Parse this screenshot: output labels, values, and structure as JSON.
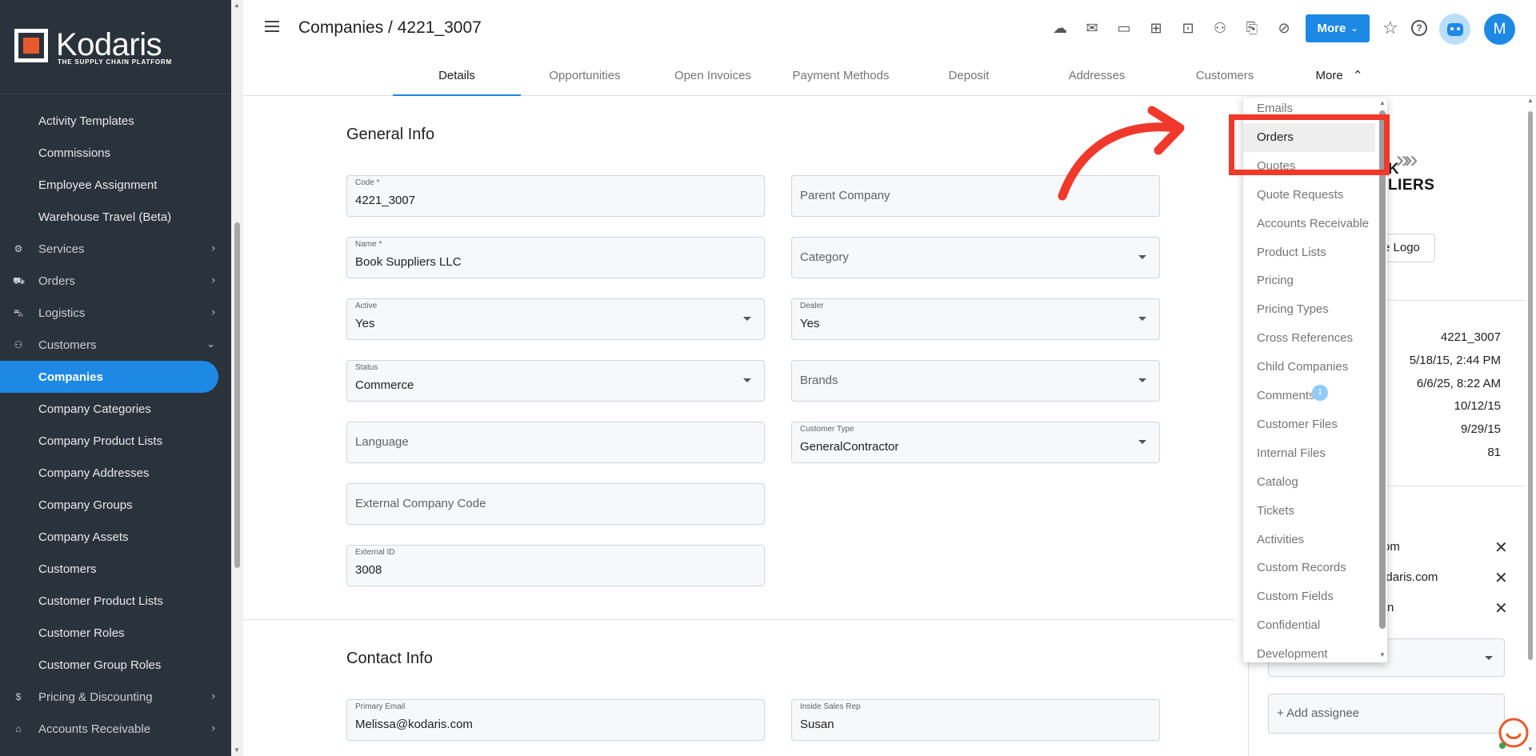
{
  "brand": {
    "name": "Kodaris",
    "tagline": "THE SUPPLY CHAIN PLATFORM"
  },
  "sidebar": {
    "items": [
      {
        "label": "Activity Templates",
        "kind": "sub"
      },
      {
        "label": "Commissions",
        "kind": "sub"
      },
      {
        "label": "Employee Assignment",
        "kind": "sub"
      },
      {
        "label": "Warehouse Travel (Beta)",
        "kind": "sub"
      },
      {
        "label": "Services",
        "kind": "top",
        "icon": "gears-icon",
        "chevron": "›"
      },
      {
        "label": "Orders",
        "kind": "top",
        "icon": "truck-icon",
        "chevron": "›"
      },
      {
        "label": "Logistics",
        "kind": "top",
        "icon": "shipping-icon",
        "chevron": "›"
      },
      {
        "label": "Customers",
        "kind": "top",
        "icon": "people-icon",
        "chevron": "⌄"
      },
      {
        "label": "Companies",
        "kind": "sub",
        "active": true
      },
      {
        "label": "Company Categories",
        "kind": "sub"
      },
      {
        "label": "Company Product Lists",
        "kind": "sub"
      },
      {
        "label": "Company Addresses",
        "kind": "sub"
      },
      {
        "label": "Company Groups",
        "kind": "sub"
      },
      {
        "label": "Company Assets",
        "kind": "sub"
      },
      {
        "label": "Customers",
        "kind": "sub"
      },
      {
        "label": "Customer Product Lists",
        "kind": "sub"
      },
      {
        "label": "Customer Roles",
        "kind": "sub"
      },
      {
        "label": "Customer Group Roles",
        "kind": "sub"
      },
      {
        "label": "Pricing & Discounting",
        "kind": "top",
        "icon": "dollar-icon",
        "chevron": "›"
      },
      {
        "label": "Accounts Receivable",
        "kind": "top",
        "icon": "bank-icon",
        "chevron": "›"
      }
    ]
  },
  "header": {
    "title": "Companies / 4221_3007",
    "more_label": "More",
    "avatar_letter": "M",
    "icons": [
      "cloud-lock-icon",
      "mail-icon",
      "card-check-icon",
      "gift-icon",
      "monitor-plus-icon",
      "person-add-icon",
      "file-plus-icon",
      "paperclip-icon"
    ]
  },
  "tabs": [
    "Details",
    "Opportunities",
    "Open Invoices",
    "Payment Methods",
    "Deposit",
    "Addresses",
    "Customers",
    "More"
  ],
  "form": {
    "general_title": "General Info",
    "contact_title": "Contact Info",
    "code": {
      "label": "Code *",
      "value": "4221_3007"
    },
    "parent_company": {
      "placeholder": "Parent Company"
    },
    "name": {
      "label": "Name *",
      "value": "Book Suppliers LLC"
    },
    "category": {
      "placeholder": "Category"
    },
    "active": {
      "label": "Active",
      "value": "Yes"
    },
    "dealer": {
      "label": "Dealer",
      "value": "Yes"
    },
    "status": {
      "label": "Status",
      "value": "Commerce"
    },
    "brands": {
      "placeholder": "Brands"
    },
    "language": {
      "placeholder": "Language"
    },
    "customer_type": {
      "label": "Customer Type",
      "value": "GeneralContractor"
    },
    "external_company_code": {
      "placeholder": "External Company Code"
    },
    "external_id": {
      "label": "External ID",
      "value": "3008"
    },
    "primary_email": {
      "label": "Primary Email",
      "value": "Melissa@kodaris.com"
    },
    "inside_sales_rep": {
      "label": "Inside Sales Rep",
      "value": "Susan"
    }
  },
  "right_panel": {
    "logo_text_top": "K",
    "logo_text": "LIERS",
    "logo_button": "e Logo",
    "values": [
      "4221_3007",
      "5/18/15, 2:44 PM",
      "6/6/25, 8:22 AM",
      "10/12/15",
      "9/29/15",
      "81"
    ],
    "emails": [
      "om",
      "a@kodaris.com",
      "n"
    ],
    "add_assignee": "+ Add assignee"
  },
  "more_menu": {
    "items": [
      "Emails",
      "Orders",
      "Quotes",
      "Quote Requests",
      "Accounts Receivable",
      "Product Lists",
      "Pricing",
      "Pricing Types",
      "Cross References",
      "Child Companies",
      "Comments",
      "Customer Files",
      "Internal Files",
      "Catalog",
      "Tickets",
      "Activities",
      "Custom Records",
      "Custom Fields",
      "Confidential",
      "Development"
    ],
    "highlighted": "Orders",
    "comments_badge": "1"
  },
  "colors": {
    "accent": "#1e88e5",
    "sidebar": "#2a323b",
    "annotation": "#f0382b",
    "brand_orange": "#e85a2b"
  }
}
